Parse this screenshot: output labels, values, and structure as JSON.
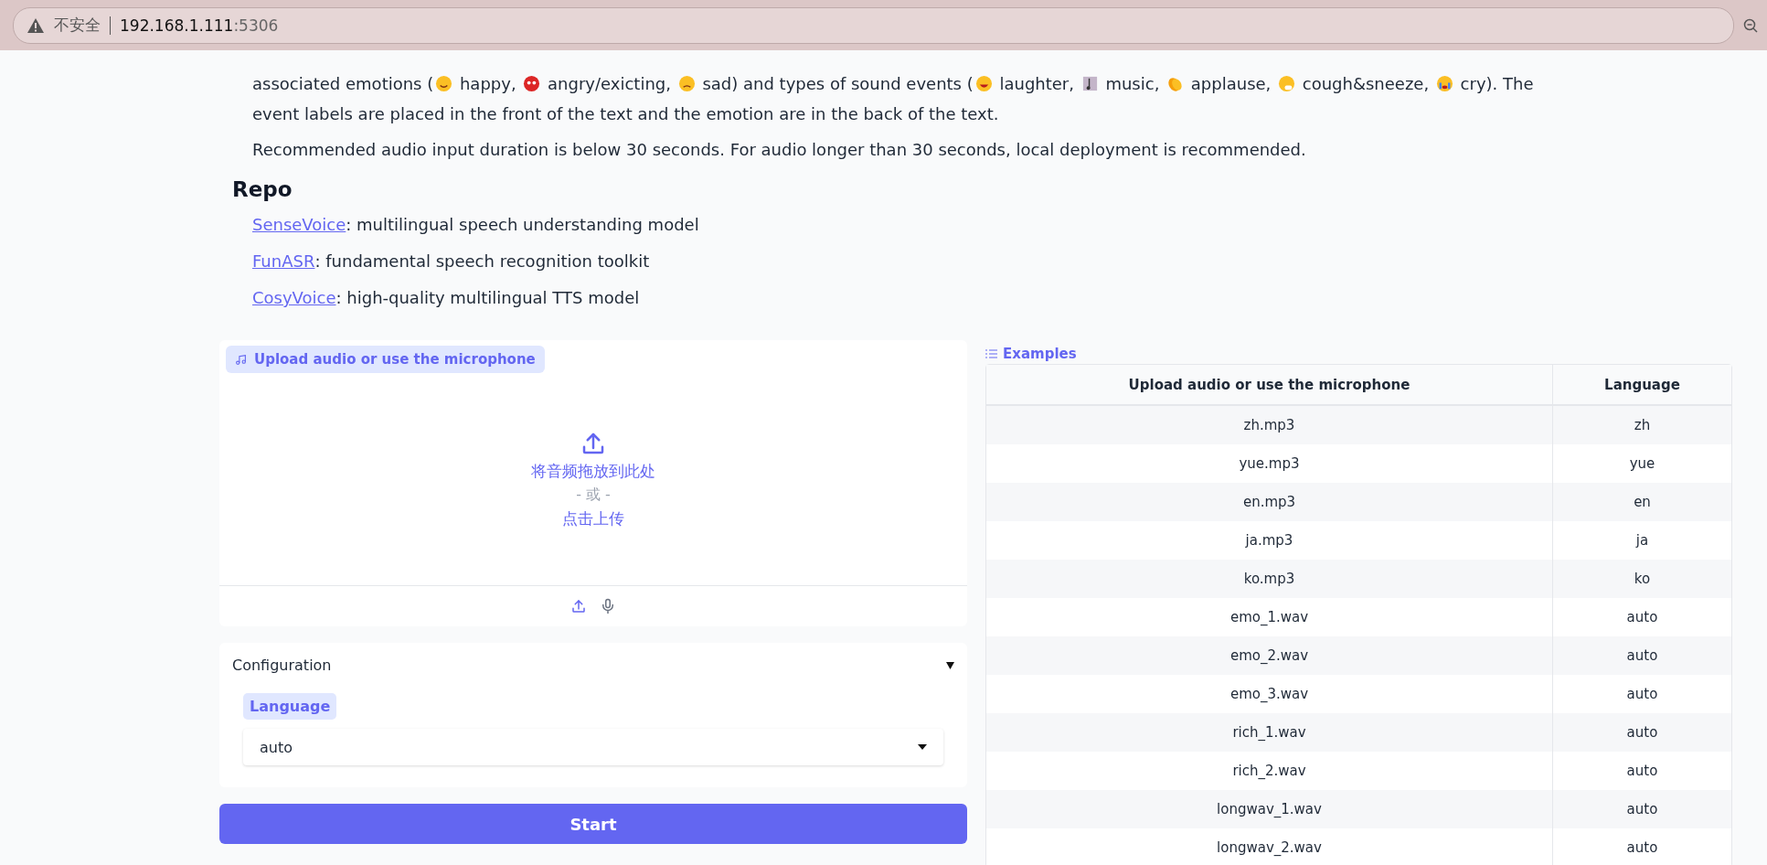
{
  "browser": {
    "security_label": "不安全",
    "host": "192.168.1.111",
    "port": ":5306"
  },
  "description": {
    "paragraphs": [
      [
        {
          "kind": "text",
          "text": "associated emotions ("
        },
        {
          "kind": "icon"
        },
        {
          "kind": "text",
          "text": " happy, "
        },
        {
          "kind": "icon"
        },
        {
          "kind": "text",
          "text": " angry/exicting, "
        },
        {
          "kind": "icon"
        },
        {
          "kind": "text",
          "text": " sad) and types of sound events ("
        },
        {
          "kind": "icon"
        },
        {
          "kind": "text",
          "text": " laughter, "
        },
        {
          "kind": "icon"
        },
        {
          "kind": "text",
          "text": " music, "
        },
        {
          "kind": "icon"
        },
        {
          "kind": "text",
          "text": " applause, "
        },
        {
          "kind": "icon"
        },
        {
          "kind": "text",
          "text": " cough&sneeze, "
        },
        {
          "kind": "icon"
        },
        {
          "kind": "text",
          "text": " cry). The"
        },
        {
          "kind": "break"
        },
        {
          "kind": "text",
          "text": "event labels are placed in the front of the text and the emotion are in the back of the text."
        }
      ],
      [
        {
          "kind": "text",
          "text": "Recommended audio input duration is below 30 seconds. For audio longer than 30 seconds, local deployment is recommended."
        }
      ]
    ]
  },
  "repo": {
    "title": "Repo",
    "links": [
      {
        "link": "SenseVoice",
        "text": ": multilingual speech understanding model"
      },
      {
        "link": "FunASR",
        "text": ": fundamental speech recognition toolkit"
      },
      {
        "link": "CosyVoice",
        "text": ": high-quality multilingual TTS model"
      }
    ]
  },
  "upload": {
    "label": "Upload audio or use the microphone",
    "drop_text": "将音频拖放到此处",
    "or_text": "- 或 -",
    "click_text": "点击上传"
  },
  "configuration": {
    "title": "Configuration",
    "expanded": true,
    "language_label": "Language",
    "language_value": "auto"
  },
  "start_button": "Start",
  "examples": {
    "title": "Examples",
    "columns": [
      "Upload audio or use the microphone",
      "Language"
    ],
    "rows": [
      [
        "zh.mp3",
        "zh"
      ],
      [
        "yue.mp3",
        "yue"
      ],
      [
        "en.mp3",
        "en"
      ],
      [
        "ja.mp3",
        "ja"
      ],
      [
        "ko.mp3",
        "ko"
      ],
      [
        "emo_1.wav",
        "auto"
      ],
      [
        "emo_2.wav",
        "auto"
      ],
      [
        "emo_3.wav",
        "auto"
      ],
      [
        "rich_1.wav",
        "auto"
      ],
      [
        "rich_2.wav",
        "auto"
      ],
      [
        "longwav_1.wav",
        "auto"
      ],
      [
        "longwav_2.wav",
        "auto"
      ]
    ]
  }
}
